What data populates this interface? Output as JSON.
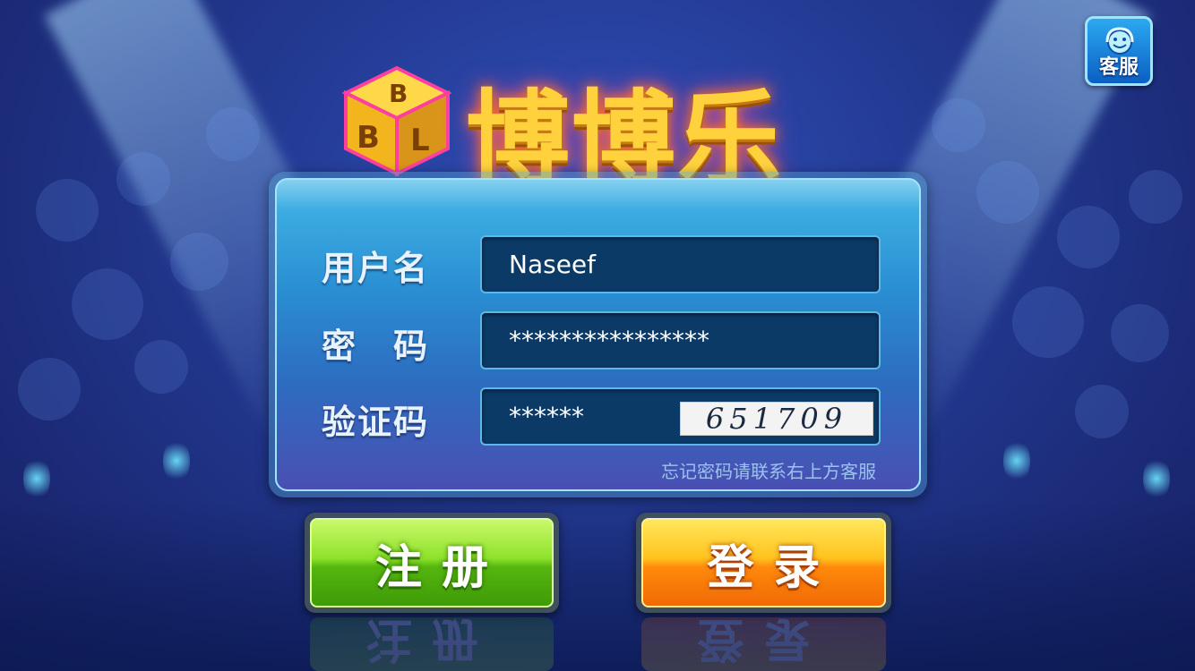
{
  "app": {
    "logo_text": "博博乐",
    "logo_cube_letters": [
      "B",
      "B",
      "L"
    ]
  },
  "service": {
    "label": "客服",
    "icon": "smiley-headset-icon"
  },
  "form": {
    "username_label": "用户名",
    "username_value": "Naseef",
    "password_label": "密　码",
    "password_value": "****************",
    "captcha_label": "验证码",
    "captcha_value": "******",
    "captcha_image_text": "651709",
    "forgot_text": "忘记密码请联系右上方客服"
  },
  "buttons": {
    "register_label": "注册",
    "login_label": "登录"
  },
  "colors": {
    "register_green": "#8ee22a",
    "login_orange": "#ffc21d",
    "field_bg": "#0b3a67",
    "logo_gold": "#ffd23d"
  }
}
